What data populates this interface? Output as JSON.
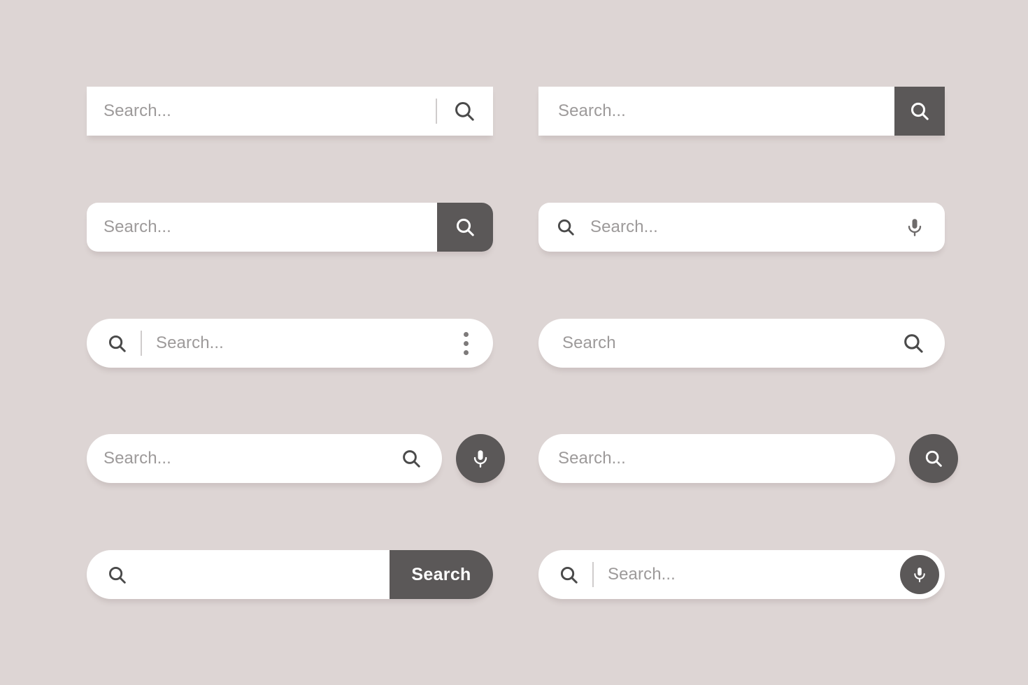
{
  "canvas": {
    "background_color": "#ddd5d4",
    "bar_color": "#ffffff",
    "accent_color": "#5b5858",
    "placeholder_color": "#9d9a9a",
    "icon_color": "#4a4a4a"
  },
  "search_bars": [
    {
      "id": "rect-divider-search",
      "shape": "rectangle",
      "placeholder": "Search...",
      "icons": [
        "search-icon"
      ],
      "divider": true
    },
    {
      "id": "rect-dark-square-button",
      "shape": "rectangle",
      "placeholder": "Search...",
      "icons": [
        "search-icon"
      ],
      "button_style": "dark-square"
    },
    {
      "id": "rounded-dark-button",
      "shape": "rounded",
      "placeholder": "Search...",
      "icons": [
        "search-icon"
      ],
      "button_style": "dark-rounded-right"
    },
    {
      "id": "rounded-search-mic",
      "shape": "rounded",
      "placeholder": "Search...",
      "icons": [
        "search-icon",
        "microphone-icon"
      ]
    },
    {
      "id": "pill-search-divider-menu",
      "shape": "pill",
      "placeholder": "Search...",
      "icons": [
        "search-icon",
        "more-vertical-icon"
      ],
      "divider": true
    },
    {
      "id": "pill-trailing-search",
      "shape": "pill",
      "placeholder": "Search",
      "icons": [
        "search-icon"
      ]
    },
    {
      "id": "pill-search-with-mic-circle",
      "shape": "pill",
      "placeholder": "Search...",
      "icons": [
        "search-icon",
        "microphone-icon"
      ],
      "button_style": "detached-circle-mic"
    },
    {
      "id": "pill-with-search-circle",
      "shape": "pill",
      "placeholder": "Search...",
      "icons": [
        "search-icon"
      ],
      "button_style": "detached-circle-search"
    },
    {
      "id": "pill-search-text-button",
      "shape": "pill",
      "placeholder": "",
      "button_label": "Search",
      "icons": [
        "search-icon"
      ],
      "button_style": "dark-pill-right-label"
    },
    {
      "id": "pill-divider-inline-mic",
      "shape": "pill",
      "placeholder": "Search...",
      "icons": [
        "search-icon",
        "microphone-icon"
      ],
      "divider": true,
      "button_style": "inline-circle-mic"
    }
  ]
}
